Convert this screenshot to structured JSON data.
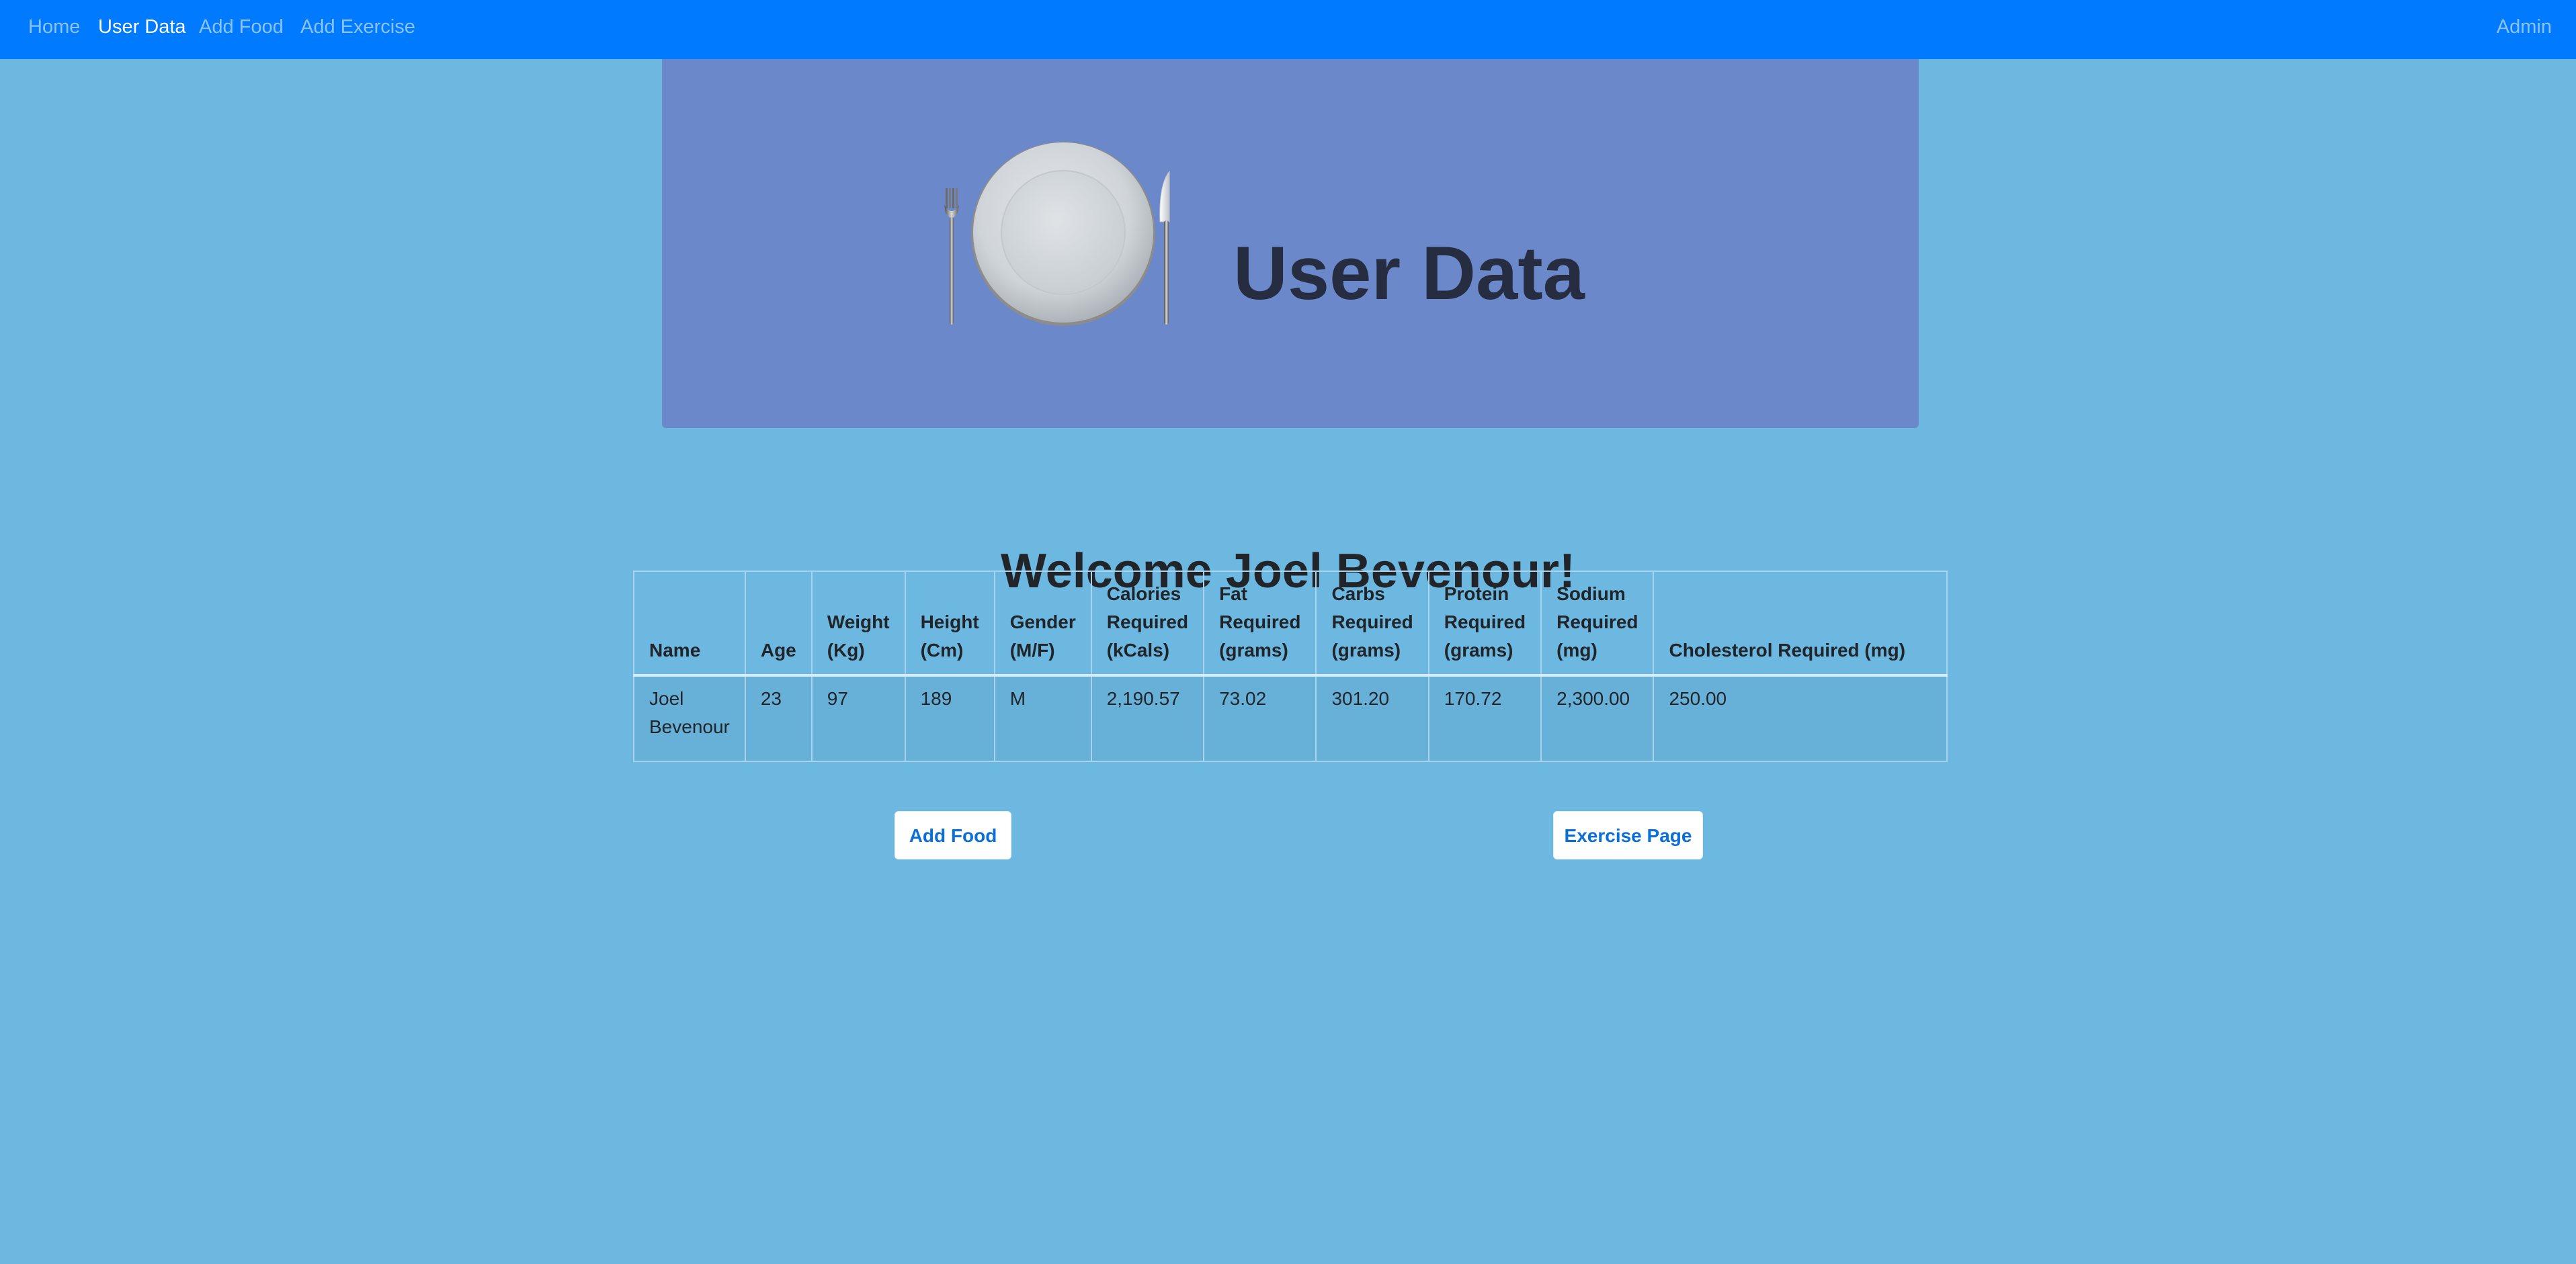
{
  "nav": {
    "items": [
      {
        "label": "Home",
        "active": false
      },
      {
        "label": "User Data",
        "active": true
      },
      {
        "label": "Add Food",
        "active": false
      },
      {
        "label": "Add Exercise",
        "active": false
      }
    ],
    "right_label": "Admin"
  },
  "banner": {
    "title": "User Data",
    "icon": "plate-fork-knife-icon"
  },
  "welcome": "Welcome Joel Bevenour!",
  "table": {
    "headers": [
      "Name",
      "Age",
      "Weight (Kg)",
      "Height (Cm)",
      "Gender (M/F)",
      "Calories Required (kCals)",
      "Fat Required (grams)",
      "Carbs Required (grams)",
      "Protein Required (grams)",
      "Sodium Required (mg)",
      "Cholesterol Required (mg)"
    ],
    "rows": [
      [
        "Joel Bevenour",
        "23",
        "97",
        "189",
        "M",
        "2,190.57",
        "73.02",
        "301.20",
        "170.72",
        "2,300.00",
        "250.00"
      ]
    ]
  },
  "buttons": {
    "add_food": "Add Food",
    "exercise_page": "Exercise Page"
  },
  "colors": {
    "navbar": "#007bff",
    "page_background": "#6cb8e0",
    "banner": "#6b88cb",
    "button_text": "#0b6fd8"
  }
}
